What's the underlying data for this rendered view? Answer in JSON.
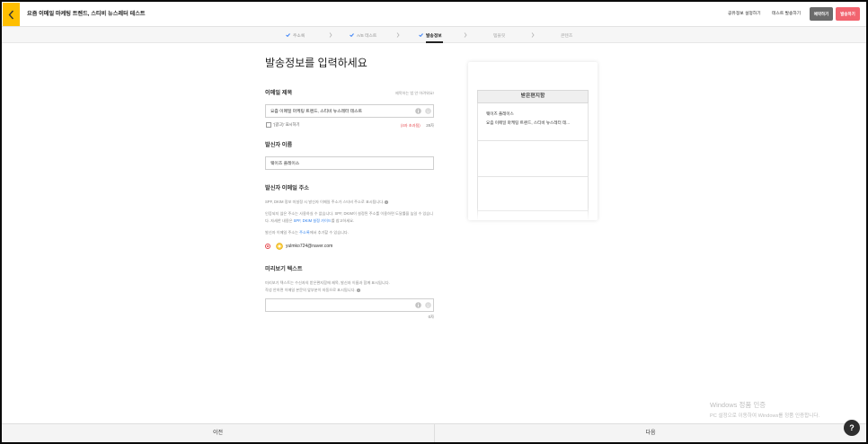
{
  "colors": {
    "back_button": "#ffbf00",
    "send_button": "#f2646f",
    "schedule_button": "#6b6b6b",
    "step_check": "#3b82f6",
    "warning_red": "#e5484d",
    "link_blue": "#2f80ed",
    "radio_selected": "#e5484d",
    "help_button": "#2e2e2e"
  },
  "icons": {
    "back": "chevron-left-icon",
    "step_done": "check-icon",
    "step_separator": "chevron-right-icon",
    "info": "info-icon",
    "emoji": "emoji-icon",
    "sender_badge": "verified-icon",
    "help": "help-icon"
  },
  "header": {
    "title": "요즘 이메일 마케팅 트렌드, 스티비 뉴스레터 테스트",
    "share_settings": "공유정보 설정하기",
    "test_send": "테스트 발송하기",
    "schedule": "예약하기",
    "send": "발송하기"
  },
  "steps": [
    {
      "label": "주소록",
      "done": true
    },
    {
      "label": "A/B 테스트",
      "done": true
    },
    {
      "label": "발송정보",
      "done": true,
      "active": true
    },
    {
      "label": "템플릿",
      "done": false
    },
    {
      "label": "콘텐츠",
      "done": false
    }
  ],
  "form": {
    "heading": "발송정보를 입력하세요",
    "subject": {
      "label": "이메일 제목",
      "hint": "제목하는 법 안 어려워요!",
      "value": "요즘 이메일 마케팅 트렌드, 스티비 뉴스레터 테스트",
      "ad_checkbox_label": "'(광고)' 표시하기",
      "ad_checked": false,
      "warning": "(4자 초과됨)",
      "count": "28자"
    },
    "sender_name": {
      "label": "발신자 이름",
      "value": "웨이즈 플레이스"
    },
    "sender_email": {
      "label": "발신자 이메일 주소",
      "desc1": "SPF, DKIM 정보 미설정 시 발신자 이메일 주소가 스티비 주소로 표시됩니다.",
      "desc2_before": "인증되지 않은 주소는 사용하실 수 없습니다. SPF, DKIM이 설정된 주소를 이용하면 도달률을 높일 수 있습니다. 자세한 내용은 ",
      "desc2_link": "SPF, DKIM 설정 가이드",
      "desc2_after": "를 참고하세요.",
      "desc3_before": "발신자 이메일 주소는 ",
      "desc3_link": "주소록",
      "desc3_after": "에서 추가할 수 있습니다.",
      "selected_address": "yulmko724@naver.com"
    },
    "preview_text": {
      "label": "미리보기 텍스트",
      "desc_line1": "미리보기 텍스트는 수신자의 받은편지함에 제목, 발신자 이름과 함께 표시됩니다.",
      "desc_line2": "작성 안하면 이메일 본문의 앞부분이 자동으로 표시됩니다.",
      "value": "",
      "count": "0자"
    }
  },
  "preview": {
    "inbox_title": "받은편지함",
    "sender": "웨이즈 플레이스",
    "subject": "요즘 이메일 마케팅 트렌드, 스티비 뉴스레터 테..."
  },
  "footer": {
    "prev": "이전",
    "next": "다음"
  },
  "watermark": {
    "title": "Windows 정품 인증",
    "subtitle": "PC 설정으로 이동하여 Windows를 정품 인증합니다."
  },
  "help_label": "?"
}
